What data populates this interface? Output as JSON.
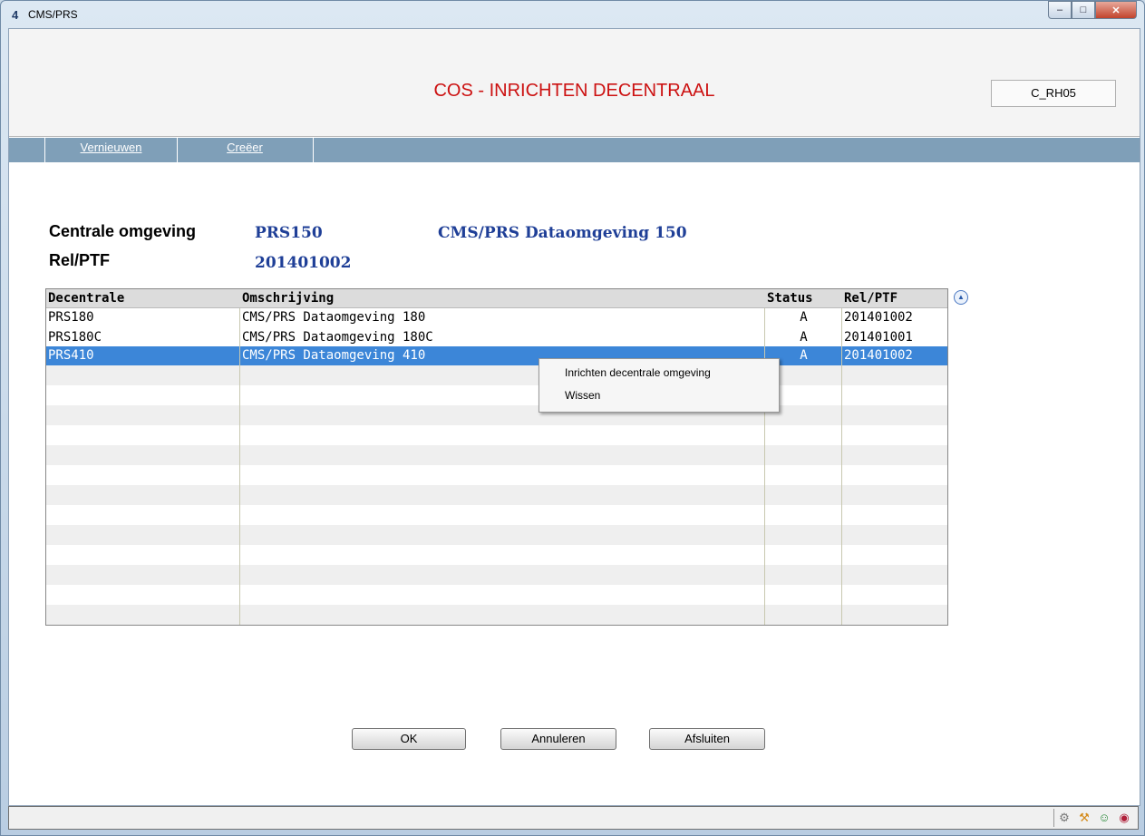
{
  "window": {
    "title": "CMS/PRS",
    "app_icon_glyph": "4"
  },
  "header": {
    "title": "COS - INRICHTEN DECENTRAAL",
    "screen_code": "C_RH05"
  },
  "menu": [
    {
      "label": "Vernieuwen",
      "accesskey": "V"
    },
    {
      "label": "Creëer",
      "accesskey": "C"
    }
  ],
  "info": {
    "central_label": "Centrale omgeving",
    "central_code": "PRS150",
    "central_desc": "CMS/PRS Dataomgeving 150",
    "relptf_label": "Rel/PTF",
    "relptf_value": "201401002"
  },
  "grid": {
    "columns": [
      "Decentrale",
      "Omschrijving",
      "Status",
      "Rel/PTF"
    ],
    "rows": [
      {
        "decentrale": "PRS180",
        "omschrijving": "CMS/PRS Dataomgeving 180",
        "status": "A",
        "relptf": "201401002"
      },
      {
        "decentrale": "PRS180C",
        "omschrijving": "CMS/PRS Dataomgeving 180C",
        "status": "A",
        "relptf": "201401001"
      },
      {
        "decentrale": "PRS410",
        "omschrijving": "CMS/PRS Dataomgeving 410",
        "status": "A",
        "relptf": "201401002"
      }
    ],
    "selected_row": 2
  },
  "context_menu": [
    {
      "label": "Inrichten decentrale omgeving",
      "accesskey": "I"
    },
    {
      "label": "Wissen",
      "accesskey": "W"
    }
  ],
  "buttons": {
    "ok": "OK",
    "cancel": "Annuleren",
    "close": "Afsluiten"
  },
  "colors": {
    "title_red": "#cc1111",
    "value_blue": "#1f3f97",
    "menubar": "#7f9fb8",
    "selection": "#3c86d8"
  }
}
